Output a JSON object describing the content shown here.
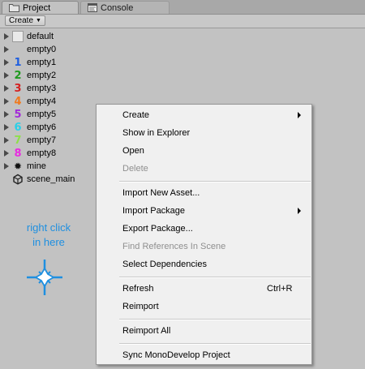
{
  "tabs": [
    {
      "label": "Project",
      "icon": "folder-icon"
    },
    {
      "label": "Console",
      "icon": "console-icon"
    }
  ],
  "toolbar": {
    "create_label": "Create"
  },
  "assets": [
    {
      "label": "default",
      "icon": "gray-square",
      "glyph": ""
    },
    {
      "label": "empty0",
      "icon": "number-0",
      "glyph": ""
    },
    {
      "label": "empty1",
      "icon": "number-1",
      "glyph": "1",
      "color": "#1f5fe0"
    },
    {
      "label": "empty2",
      "icon": "number-2",
      "glyph": "2",
      "color": "#1f9a1f"
    },
    {
      "label": "empty3",
      "icon": "number-3",
      "glyph": "3",
      "color": "#d42020"
    },
    {
      "label": "empty4",
      "icon": "number-4",
      "glyph": "4",
      "color": "#f07a1e"
    },
    {
      "label": "empty5",
      "icon": "number-5",
      "glyph": "5",
      "color": "#a22ad9"
    },
    {
      "label": "empty6",
      "icon": "number-6",
      "glyph": "6",
      "color": "#28d0e8"
    },
    {
      "label": "empty7",
      "icon": "number-7",
      "glyph": "7",
      "color": "#8ee04a"
    },
    {
      "label": "empty8",
      "icon": "number-8",
      "glyph": "8",
      "color": "#e82ae0"
    },
    {
      "label": "mine",
      "icon": "gear-icon",
      "glyph": "✹",
      "color": "#111111"
    },
    {
      "label": "scene_main",
      "icon": "unity-scene-icon",
      "glyph": ""
    }
  ],
  "hint": {
    "line1": "right click",
    "line2": "in here",
    "color": "#1e8fe0"
  },
  "menu": {
    "items": [
      {
        "label": "Create",
        "submenu": true
      },
      {
        "label": "Show in Explorer"
      },
      {
        "label": "Open"
      },
      {
        "label": "Delete",
        "disabled": true
      },
      {
        "label": "Import New Asset..."
      },
      {
        "label": "Import Package",
        "submenu": true
      },
      {
        "label": "Export Package..."
      },
      {
        "label": "Find References In Scene",
        "disabled": true
      },
      {
        "label": "Select Dependencies"
      },
      {
        "label": "Refresh",
        "shortcut": "Ctrl+R"
      },
      {
        "label": "Reimport"
      },
      {
        "label": "Reimport All"
      },
      {
        "label": "Sync MonoDevelop Project"
      }
    ]
  }
}
